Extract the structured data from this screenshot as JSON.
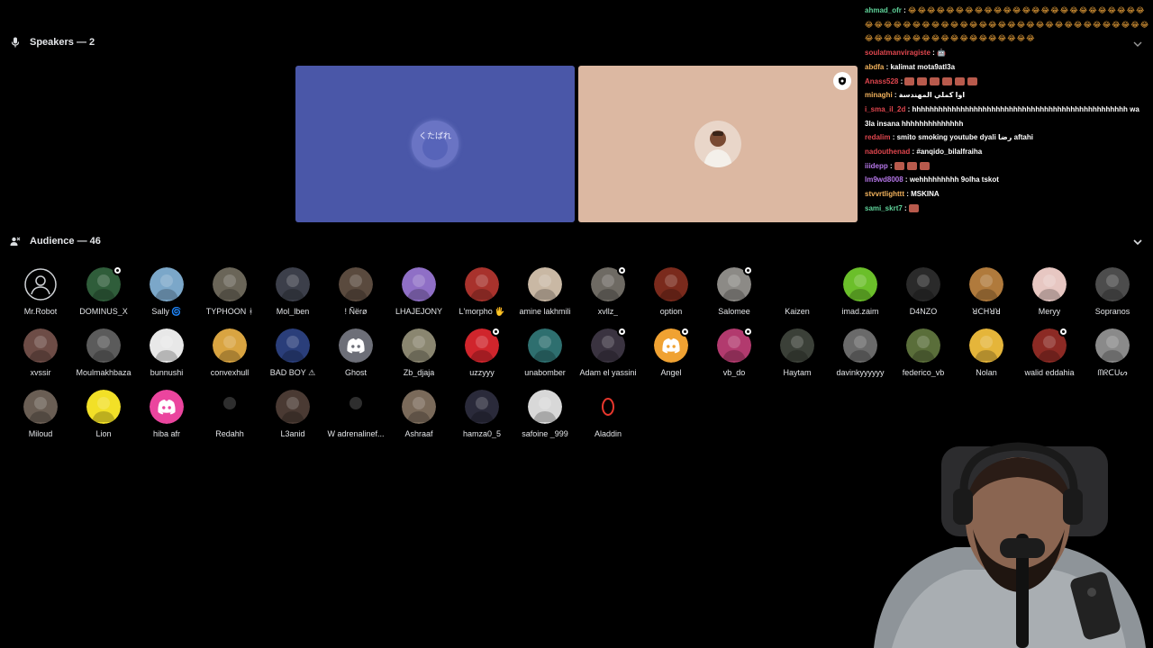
{
  "speakers": {
    "header": "Speakers — 2",
    "tiles": [
      {
        "avatar_text": "くたばれ",
        "bg": "#4a57a8"
      },
      {
        "avatar_text": "",
        "bg": "#dcb8a2"
      }
    ]
  },
  "audience": {
    "header": "Audience — 46",
    "members": [
      {
        "name": "Mr.Robot",
        "avatar": "#1a1a1a",
        "kind": "outline"
      },
      {
        "name": "DOMINUS_X",
        "avatar": "#2f5d3a",
        "dot": true
      },
      {
        "name": "Sally 🌀",
        "avatar": "#7ba7c9"
      },
      {
        "name": "TYPHOON ᚼ",
        "avatar": "#6a6558"
      },
      {
        "name": "Mol_lben",
        "avatar": "#3c3f4a"
      },
      {
        "name": "! Ñërø",
        "avatar": "#5a4a3e"
      },
      {
        "name": "LHAJEJONY",
        "avatar": "#8f6fc6"
      },
      {
        "name": "L'morpho 🖐",
        "avatar": "#a8322c"
      },
      {
        "name": "amine lakhmili",
        "avatar": "#c9b8a4"
      },
      {
        "name": "xvllz_",
        "avatar": "#6e6a63",
        "dot": true
      },
      {
        "name": "option",
        "avatar": "#7a2a1c"
      },
      {
        "name": "Salomee",
        "avatar": "#8c8a86",
        "dot": true
      },
      {
        "name": "Kaizen",
        "avatar": "#000000",
        "kind": "blank"
      },
      {
        "name": "imad.zaim",
        "avatar": "#6bbf2a"
      },
      {
        "name": "D4NZO",
        "avatar": "#2a2a2a"
      },
      {
        "name": "ꓤꓚꓧꓤꓤ",
        "avatar": "#b07a3c"
      },
      {
        "name": "Meryy",
        "avatar": "#e7c7c2"
      },
      {
        "name": "Sopranos",
        "avatar": "#4c4c4c"
      },
      {
        "name": "xvssir",
        "avatar": "#6d4c46"
      },
      {
        "name": "Moulmakhbaza",
        "avatar": "#5b5b5b"
      },
      {
        "name": "bunnushi",
        "avatar": "#e8e8e8"
      },
      {
        "name": "convexhull",
        "avatar": "#d9a441"
      },
      {
        "name": "BAD BOY ⚠",
        "avatar": "#2a3e7a"
      },
      {
        "name": "Ghost",
        "avatar": "#6d6f78",
        "kind": "discord"
      },
      {
        "name": "Zb_djaja",
        "avatar": "#8a8670"
      },
      {
        "name": "uzzyyy",
        "avatar": "#d0252c",
        "dot": true
      },
      {
        "name": "unabomber",
        "avatar": "#2e6f6f"
      },
      {
        "name": "Adam el yassini",
        "avatar": "#3a3340",
        "dot": true
      },
      {
        "name": "Angel",
        "avatar": "#f0a232",
        "kind": "discord",
        "dot": true
      },
      {
        "name": "vb_do",
        "avatar": "#b23a6e",
        "dot": true
      },
      {
        "name": "Haytam",
        "avatar": "#3b4038"
      },
      {
        "name": "davinkyyyyyy",
        "avatar": "#6a6a6a"
      },
      {
        "name": "federico_vb",
        "avatar": "#5a6e3a"
      },
      {
        "name": "Nolan",
        "avatar": "#e5b53a"
      },
      {
        "name": "walid eddahia",
        "avatar": "#8c2a24",
        "dot": true
      },
      {
        "name": "ᗰᖇᑕᑌᔕ",
        "avatar": "#8a8a8a"
      },
      {
        "name": "Miloud",
        "avatar": "#6a5e54"
      },
      {
        "name": "Lion",
        "avatar": "#f2e027"
      },
      {
        "name": "hiba afr",
        "avatar": "#eb459e",
        "kind": "discord"
      },
      {
        "name": "Redahh",
        "avatar": "#000000"
      },
      {
        "name": "L3anid",
        "avatar": "#4a3a33"
      },
      {
        "name": "W adrenalinef...",
        "avatar": "#000000"
      },
      {
        "name": "Ashraaf",
        "avatar": "#7a6a5a"
      },
      {
        "name": "hamza0_5",
        "avatar": "#2a2a3a"
      },
      {
        "name": "safoine _999",
        "avatar": "#d8d8d8"
      },
      {
        "name": "Aladdin",
        "avatar": "#000000",
        "kind": "ring"
      }
    ]
  },
  "chat": {
    "lines": [
      {
        "user": "ahmad_ofr",
        "color": "#5fd39a",
        "text": "",
        "emoji": "😂😂😂😂😂😂😂😂😂😂😂😂😂😂😂😂😂😂😂😂😂😂😂😂😂😂😂😂😂😂😂😂😂😂😂😂😂😂😂😂😂😂😂😂😂😂😂😂😂😂😂😂😂😂😂😂😂😂😂😂😂😂😂😂😂😂😂😂😂😂😂😂😂"
      },
      {
        "user": "soulatmanviragiste",
        "color": "#e0464e",
        "text": "🤖",
        "emoji": ""
      },
      {
        "user": "abdfa",
        "color": "#f2b25c",
        "text": "kalimat mota9atl3a",
        "emoji": ""
      },
      {
        "user": "Anass528",
        "color": "#e0464e",
        "text": "",
        "emotes": 6
      },
      {
        "user": "minaghi",
        "color": "#f2b25c",
        "text": "اوا كملي المهندسة",
        "emoji": ""
      },
      {
        "user": "i_sma_il_2d",
        "color": "#e0464e",
        "text": "hhhhhhhhhhhhhhhhhhhhhhhhhhhhhhhhhhhhhhhhhhhhhhhhh wa 3la insana hhhhhhhhhhhhhh",
        "emoji": ""
      },
      {
        "user": "redalim",
        "color": "#e0464e",
        "text": "smito smoking youtube dyali رضا aftahi",
        "emoji": ""
      },
      {
        "user": "nadouthenad",
        "color": "#e0464e",
        "text": "#anqido_bilalfraiha",
        "emoji": ""
      },
      {
        "user": "iiidepp",
        "color": "#b576e8",
        "text": "",
        "emotes": 3
      },
      {
        "user": "lm9wd8008",
        "color": "#b576e8",
        "text": "wehhhhhhhhh 9olha tskot",
        "emoji": ""
      },
      {
        "user": "stvvrtlighttt",
        "color": "#f2b25c",
        "text": "MSKINA",
        "emoji": ""
      },
      {
        "user": "sami_skrt7",
        "color": "#5fd39a",
        "text": "",
        "emotes": 1
      }
    ]
  }
}
